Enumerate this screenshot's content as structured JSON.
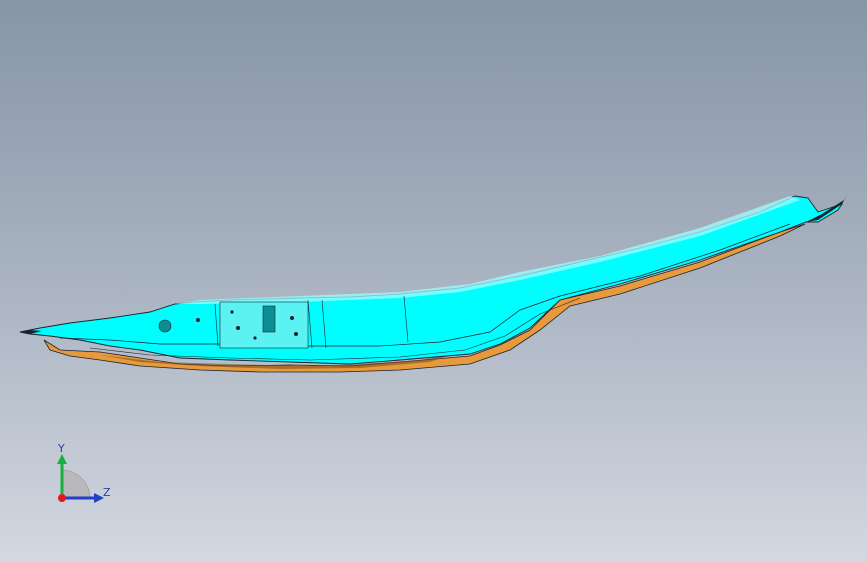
{
  "viewport": {
    "background_top": "#8795a6",
    "background_bottom": "#d3d8e1"
  },
  "model": {
    "part_color": "#00fefe",
    "underside_color": "#e79a3c",
    "edge_color": "#1c2230"
  },
  "triad": {
    "y_label": "Y",
    "z_label": "Z",
    "y_color": "#18b043",
    "z_color": "#2440c8",
    "x_color": "#e01a1a"
  }
}
